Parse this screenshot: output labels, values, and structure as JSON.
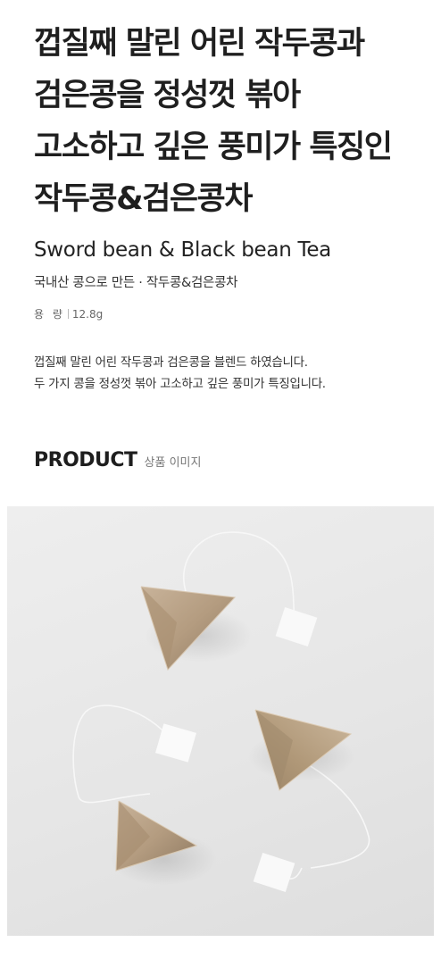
{
  "headline": {
    "lines": [
      "껍질째 말린 어린 작두콩과",
      "검은콩을 정성껏 볶아",
      "고소하고 깊은 풍미가 특징인",
      "작두콩&검은콩차"
    ]
  },
  "product": {
    "english_name": "Sword bean & Black bean Tea",
    "korean_subtitle": "국내산 콩으로 만든 · 작두콩&검은콩차",
    "spec_label": "용 량",
    "spec_value": "12.8g"
  },
  "description": {
    "lines": [
      "껍질째 말린 어린 작두콩과 검은콩을 블렌드 하였습니다.",
      "두 가지 콩을 정성껏 볶아 고소하고 깊은 풍미가 특징입니다."
    ]
  },
  "section": {
    "title": "PRODUCT",
    "subtitle": "상품 이미지"
  },
  "colors": {
    "text": "#1e1e1e",
    "photo_background": "#e8e8e8",
    "teabag": "#b9a289"
  }
}
